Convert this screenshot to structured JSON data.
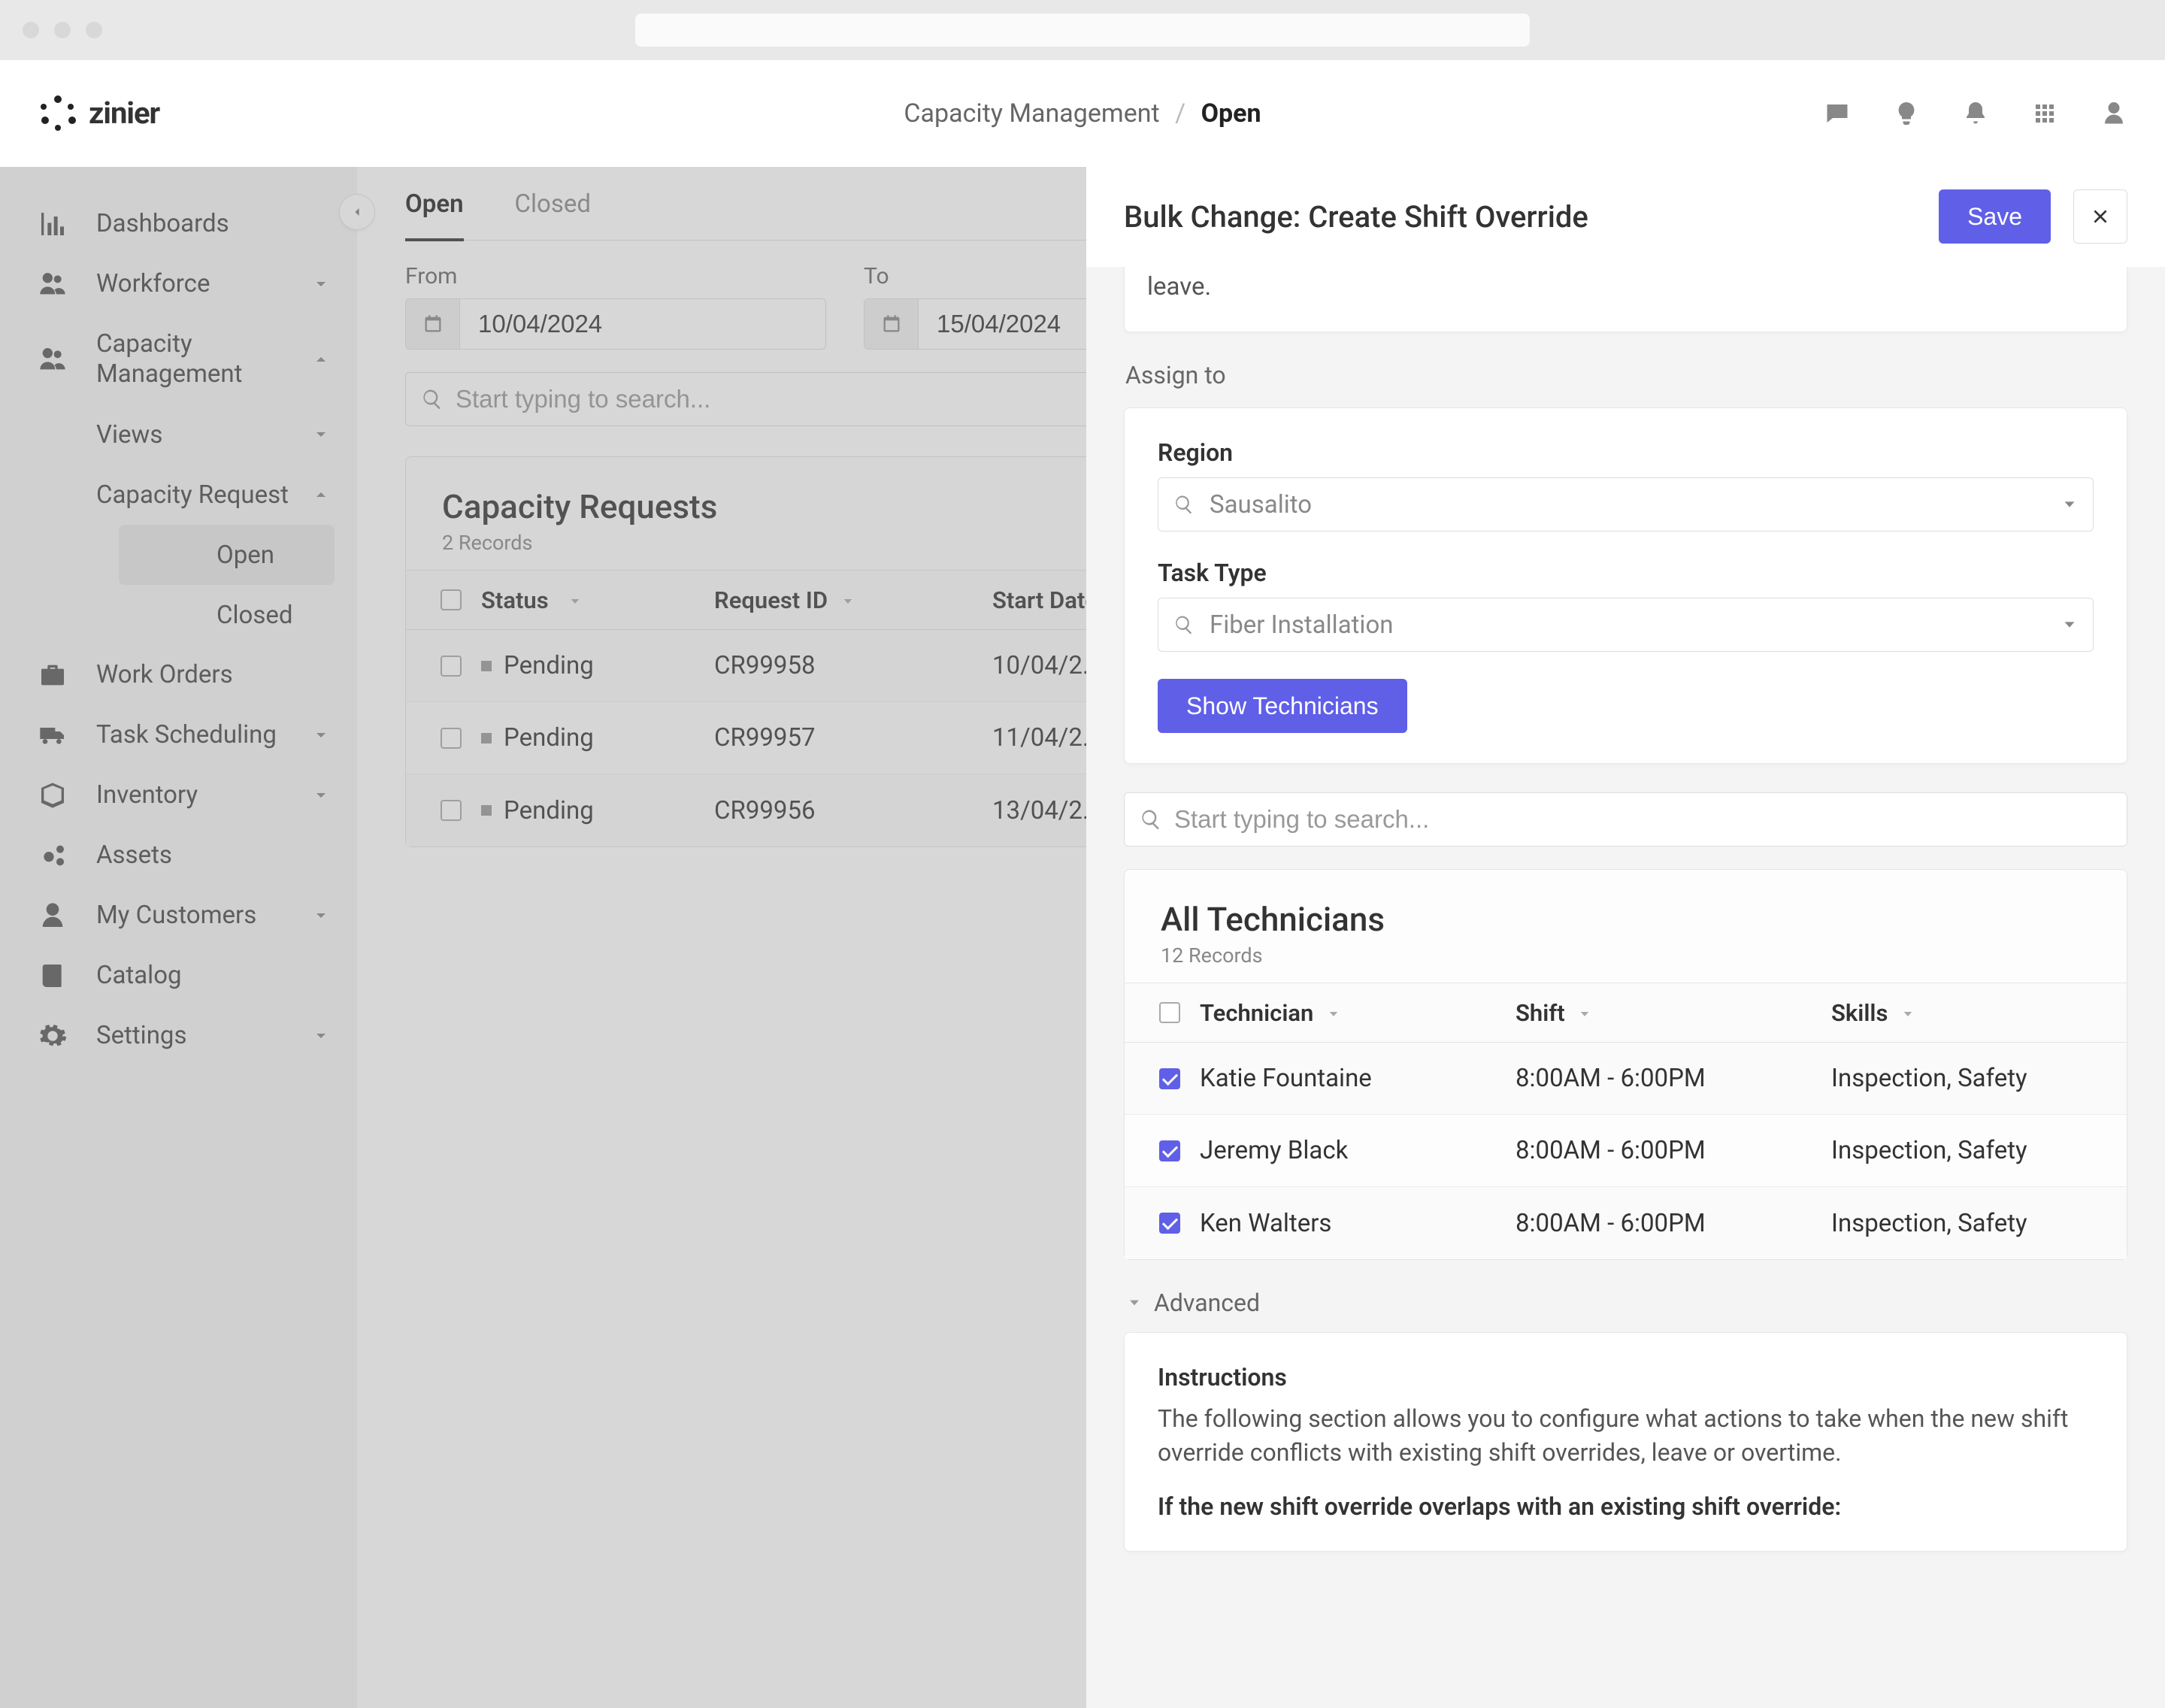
{
  "brand": "zinier",
  "breadcrumb": {
    "section": "Capacity Management",
    "current": "Open"
  },
  "sidebar": {
    "items": [
      {
        "label": "Dashboards",
        "icon": "chart"
      },
      {
        "label": "Workforce",
        "icon": "users",
        "expandable": true
      },
      {
        "label": "Capacity Management",
        "icon": "users",
        "expandable": true,
        "open": true,
        "children": [
          {
            "label": "Views",
            "expandable": true
          },
          {
            "label": "Capacity Request",
            "expandable": true,
            "open": true,
            "children": [
              {
                "label": "Open",
                "active": true
              },
              {
                "label": "Closed"
              }
            ]
          }
        ]
      },
      {
        "label": "Work Orders",
        "icon": "briefcase"
      },
      {
        "label": "Task Scheduling",
        "icon": "truck",
        "expandable": true
      },
      {
        "label": "Inventory",
        "icon": "box",
        "expandable": true
      },
      {
        "label": "Assets",
        "icon": "cog-group"
      },
      {
        "label": "My Customers",
        "icon": "person",
        "expandable": true
      },
      {
        "label": "Catalog",
        "icon": "book"
      },
      {
        "label": "Settings",
        "icon": "gear",
        "expandable": true
      }
    ]
  },
  "tabs": [
    {
      "label": "Open",
      "active": true
    },
    {
      "label": "Closed"
    }
  ],
  "filters": {
    "from": {
      "label": "From",
      "value": "10/04/2024"
    },
    "to": {
      "label": "To",
      "value": "15/04/2024"
    }
  },
  "search_placeholder": "Start typing to search...",
  "requests": {
    "title": "Capacity Requests",
    "records_label": "2 Records",
    "columns": [
      "Status",
      "Request ID",
      "Start Date"
    ],
    "rows": [
      {
        "status": "Pending",
        "id": "CR99958",
        "date": "10/04/2..."
      },
      {
        "status": "Pending",
        "id": "CR99957",
        "date": "11/04/2..."
      },
      {
        "status": "Pending",
        "id": "CR99956",
        "date": "13/04/2..."
      }
    ]
  },
  "drawer": {
    "title": "Bulk Change: Create Shift Override",
    "save": "Save",
    "note": "leave.",
    "assign_label": "Assign to",
    "region": {
      "label": "Region",
      "value": "Sausalito"
    },
    "task_type": {
      "label": "Task Type",
      "value": "Fiber Installation"
    },
    "show_btn": "Show Technicians",
    "search_placeholder": "Start typing to search...",
    "tech_title": "All Technicians",
    "tech_records": "12 Records",
    "tech_columns": [
      "Technician",
      "Shift",
      "Skills"
    ],
    "technicians": [
      {
        "name": "Katie Fountaine",
        "shift": "8:00AM - 6:00PM",
        "skills": "Inspection, Safety",
        "checked": true
      },
      {
        "name": "Jeremy Black",
        "shift": "8:00AM - 6:00PM",
        "skills": "Inspection, Safety",
        "checked": true
      },
      {
        "name": "Ken Walters",
        "shift": "8:00AM - 6:00PM",
        "skills": "Inspection, Safety",
        "checked": true
      }
    ],
    "advanced": "Advanced",
    "instructions": {
      "title": "Instructions",
      "body": "The following section allows you to configure what actions to take when the new shift override conflicts with existing shift overrides, leave or overtime.",
      "sub": "If the new shift override overlaps with an existing shift override:"
    }
  }
}
